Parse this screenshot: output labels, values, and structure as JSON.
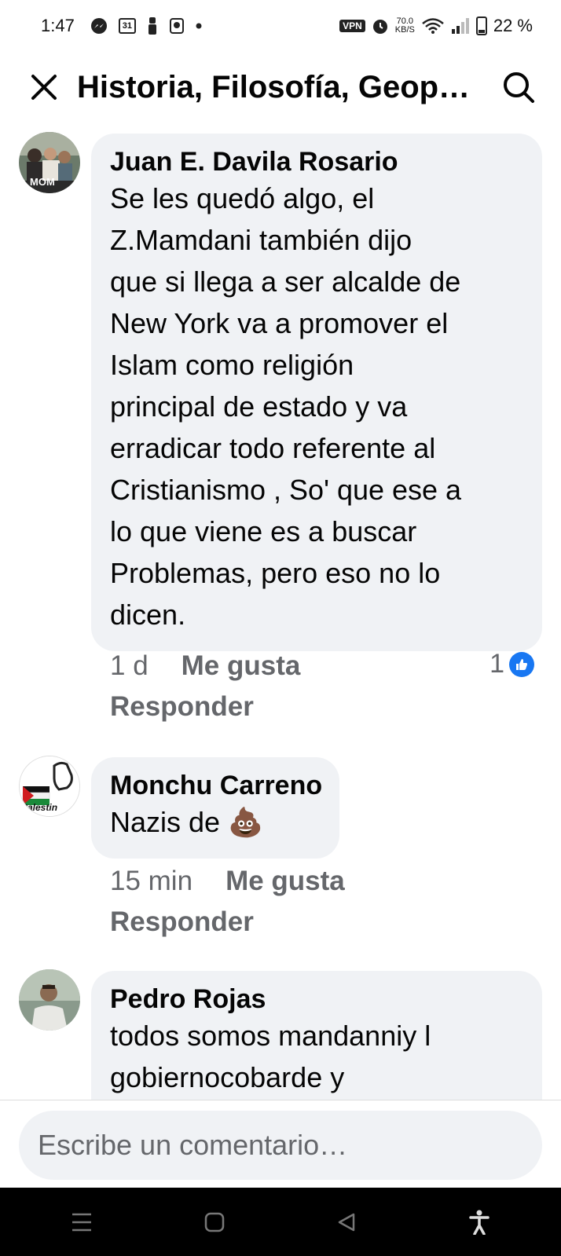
{
  "status_bar": {
    "time": "1:47",
    "calendar_day": "31",
    "vpn_label": "VPN",
    "net_speed_value": "70.0",
    "net_speed_unit": "KB/S",
    "battery_percent": "22 %",
    "battery_level": 0.22
  },
  "header": {
    "title": "Historia, Filosofía, Geop…"
  },
  "comments": [
    {
      "author": "Juan E. Davila Rosario",
      "text": "Se les quedó algo, el\nZ.Mamdani también dijo\nque si llega a ser alcalde de\nNew York va a promover el\nIslam como religión\nprincipal de estado y va\nerradicar todo referente al\nCristianismo , So' que ese a\nlo que viene es a buscar\nProblemas, pero  eso no lo\ndicen.",
      "time": "1 d",
      "like_label": "Me gusta",
      "reply_label": "Responder",
      "reaction_count": "1",
      "avatar_overlay": "MOM"
    },
    {
      "author": "Monchu Carreno",
      "text": "Nazis de 💩",
      "time": "15 min",
      "like_label": "Me gusta",
      "reply_label": "Responder",
      "avatar_overlay": "Palestin"
    },
    {
      "author": "Pedro Rojas",
      "text": "todos somos mandanniy l\ngobiernocobarde y"
    }
  ],
  "composer": {
    "placeholder": "Escribe un comentario…"
  },
  "colors": {
    "bubble_bg": "#f0f2f5",
    "meta_text": "#65676b",
    "like_blue": "#1877f2"
  }
}
